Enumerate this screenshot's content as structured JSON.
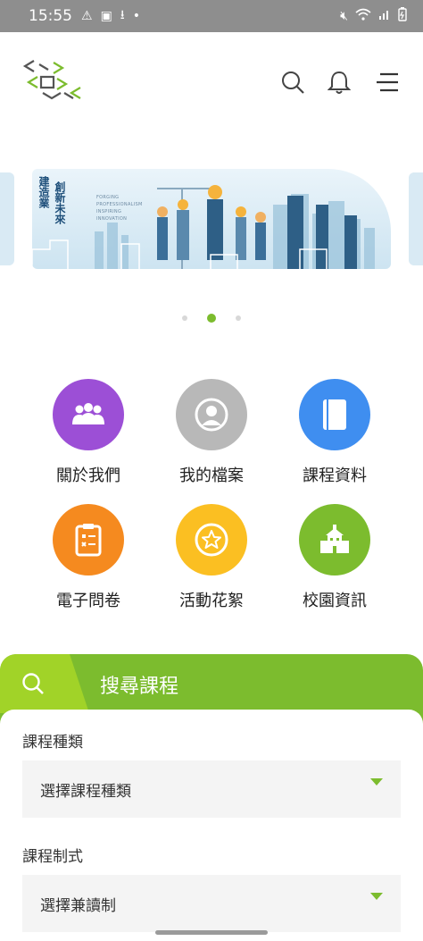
{
  "status_bar": {
    "time": "15:55"
  },
  "banner": {
    "vertical_text_1": "建造業",
    "vertical_text_2": "創新未來",
    "english_lines": [
      "FORGING",
      "PROFESSIONALISM",
      "INSPIRING",
      "INNOVATION"
    ]
  },
  "grid": [
    {
      "label": "關於我們",
      "color": "#9c4fd6",
      "icon": "people-icon"
    },
    {
      "label": "我的檔案",
      "color": "#b8b8b8",
      "icon": "profile-icon"
    },
    {
      "label": "課程資料",
      "color": "#3f8ef0",
      "icon": "book-icon"
    },
    {
      "label": "電子問卷",
      "color": "#f58a1f",
      "icon": "clipboard-icon"
    },
    {
      "label": "活動花絮",
      "color": "#fbbf22",
      "icon": "star-icon"
    },
    {
      "label": "校園資訊",
      "color": "#7cbc2e",
      "icon": "school-icon"
    }
  ],
  "search": {
    "title": "搜尋課程",
    "course_type_label": "課程種類",
    "course_type_value": "選擇課程種類",
    "course_mode_label": "課程制式",
    "course_mode_value": "選擇兼讀制"
  },
  "colors": {
    "accent": "#7cbc2e",
    "accent_light": "#a1d328"
  }
}
